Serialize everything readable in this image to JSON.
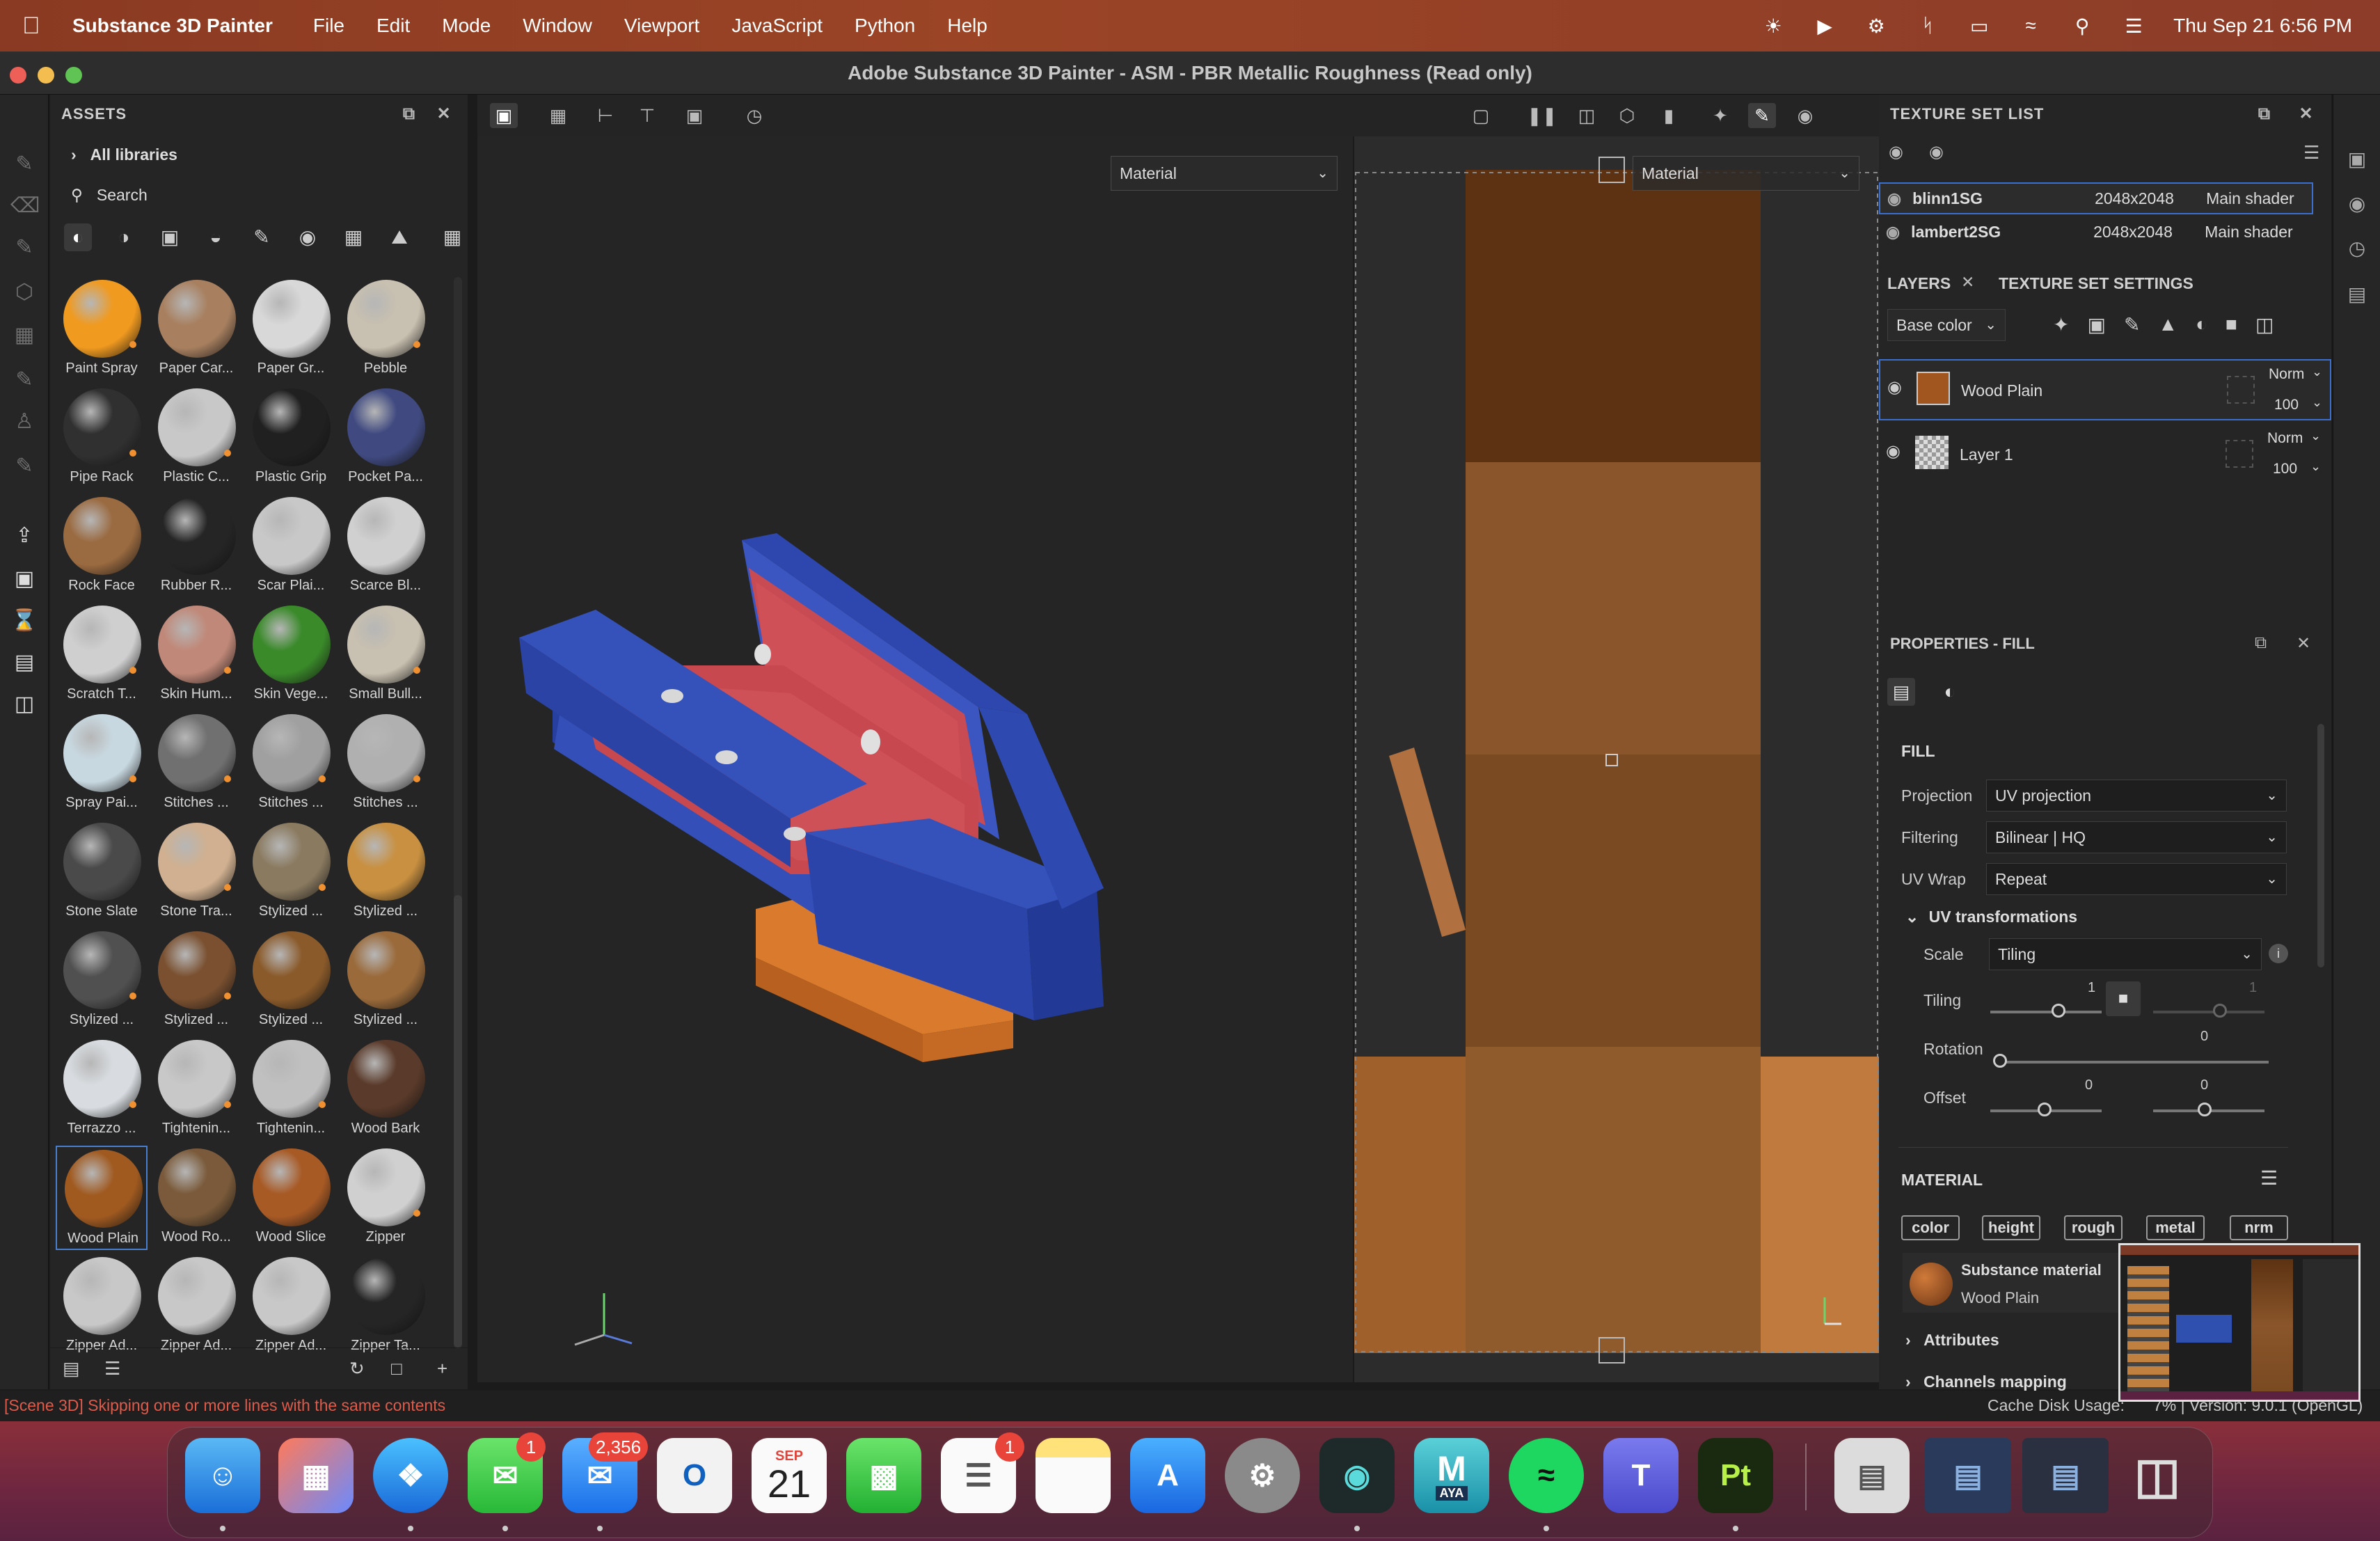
{
  "menubar": {
    "app_name": "Substance 3D Painter",
    "items": [
      "File",
      "Edit",
      "Mode",
      "Window",
      "Viewport",
      "JavaScript",
      "Python",
      "Help"
    ],
    "datetime": "Thu Sep 21  6:56 PM"
  },
  "window": {
    "title": "Adobe Substance 3D Painter - ASM - PBR Metallic Roughness (Read only)"
  },
  "assets": {
    "title": "ASSETS",
    "all_libraries": "All libraries",
    "search_placeholder": "Search",
    "items": [
      {
        "label": "Paint Spray",
        "color": "#f09a20"
      },
      {
        "label": "Paper Car...",
        "color": "#a88060"
      },
      {
        "label": "Paper Gr...",
        "color": "#d8d8d8"
      },
      {
        "label": "Pebble",
        "color": "#c8c0b0"
      },
      {
        "label": "Pipe Rack",
        "color": "#303030"
      },
      {
        "label": "Plastic C...",
        "color": "#c8c8c8"
      },
      {
        "label": "Plastic Grip",
        "color": "#202020"
      },
      {
        "label": "Pocket Pa...",
        "color": "#404a80"
      },
      {
        "label": "Rock Face",
        "color": "#9a6a40"
      },
      {
        "label": "Rubber R...",
        "color": "#252525"
      },
      {
        "label": "Scar Plai...",
        "color": "#c8c8c8"
      },
      {
        "label": "Scarce Bl...",
        "color": "#d0d0d0"
      },
      {
        "label": "Scratch T...",
        "color": "#cfcfcf"
      },
      {
        "label": "Skin Hum...",
        "color": "#c08878"
      },
      {
        "label": "Skin Vege...",
        "color": "#3a8a2a"
      },
      {
        "label": "Small Bull...",
        "color": "#c8c0b0"
      },
      {
        "label": "Spray Pai...",
        "color": "#c8d8e0"
      },
      {
        "label": "Stitches ...",
        "color": "#707070"
      },
      {
        "label": "Stitches ...",
        "color": "#a0a0a0"
      },
      {
        "label": "Stitches ...",
        "color": "#b0b0b0"
      },
      {
        "label": "Stone Slate",
        "color": "#4a4a4a"
      },
      {
        "label": "Stone Tra...",
        "color": "#d0b090"
      },
      {
        "label": "Stylized ...",
        "color": "#8a7a60"
      },
      {
        "label": "Stylized ...",
        "color": "#c89040"
      },
      {
        "label": "Stylized ...",
        "color": "#505050"
      },
      {
        "label": "Stylized ...",
        "color": "#7a5030"
      },
      {
        "label": "Stylized ...",
        "color": "#8a5a2a"
      },
      {
        "label": "Stylized ...",
        "color": "#9a6a3a"
      },
      {
        "label": "Terrazzo ...",
        "color": "#d8dce0"
      },
      {
        "label": "Tightenin...",
        "color": "#c8c8c8"
      },
      {
        "label": "Tightenin...",
        "color": "#c0c0c0"
      },
      {
        "label": "Wood Bark",
        "color": "#5a3a2a"
      },
      {
        "label": "Wood Plain",
        "color": "#a05a20"
      },
      {
        "label": "Wood Ro...",
        "color": "#7a5a3a"
      },
      {
        "label": "Wood Slice",
        "color": "#a85a25"
      },
      {
        "label": "Zipper",
        "color": "#d0d0d0"
      },
      {
        "label": "Zipper Ad...",
        "color": "#c8c8c8"
      },
      {
        "label": "Zipper Ad...",
        "color": "#c8c8c8"
      },
      {
        "label": "Zipper Ad...",
        "color": "#c8c8c8"
      },
      {
        "label": "Zipper Ta...",
        "color": "#252525"
      }
    ],
    "selected": "Wood Plain"
  },
  "viewport": {
    "left_mode": "Material",
    "right_mode": "Material"
  },
  "texture_set_list": {
    "title": "TEXTURE SET LIST",
    "rows": [
      {
        "name": "blinn1SG",
        "size": "2048x2048",
        "shader": "Main shader"
      },
      {
        "name": "lambert2SG",
        "size": "2048x2048",
        "shader": "Main shader"
      }
    ]
  },
  "layers": {
    "tab_layers": "LAYERS",
    "tab_settings": "TEXTURE SET SETTINGS",
    "channel": "Base color",
    "items": [
      {
        "name": "Wood Plain",
        "blend": "Norm",
        "opacity": "100"
      },
      {
        "name": "Layer 1",
        "blend": "Norm",
        "opacity": "100"
      }
    ]
  },
  "properties": {
    "title": "PROPERTIES - FILL",
    "fill_header": "FILL",
    "projection_label": "Projection",
    "projection_value": "UV projection",
    "filtering_label": "Filtering",
    "filtering_value": "Bilinear | HQ",
    "uvwrap_label": "UV Wrap",
    "uvwrap_value": "Repeat",
    "uvtrans_label": "UV transformations",
    "scale_label": "Scale",
    "scale_value": "Tiling",
    "tiling_label": "Tiling",
    "tiling_value_1": "1",
    "tiling_value_2": "1",
    "rotation_label": "Rotation",
    "rotation_value": "0",
    "offset_label": "Offset",
    "offset_value_1": "0",
    "offset_value_2": "0",
    "material_header": "MATERIAL",
    "chips": [
      "color",
      "height",
      "rough",
      "metal",
      "nrm"
    ],
    "material_source": "Substance material",
    "material_name": "Wood Plain",
    "attributes_label": "Attributes",
    "channels_mapping_label": "Channels mapping"
  },
  "status": {
    "error": "[Scene 3D] Skipping one or more lines with the same contents",
    "cache": "Cache Disk Usage:",
    "version": "7% | Version: 9.0.1 (OpenGL)"
  },
  "dock": {
    "messages_badge": "1",
    "mail_badge": "2,356",
    "calendar_month": "SEP",
    "calendar_day": "21",
    "reminders_badge": "1",
    "maya_label": "M",
    "maya_sub": "AYA",
    "pt_label": "Pt"
  }
}
